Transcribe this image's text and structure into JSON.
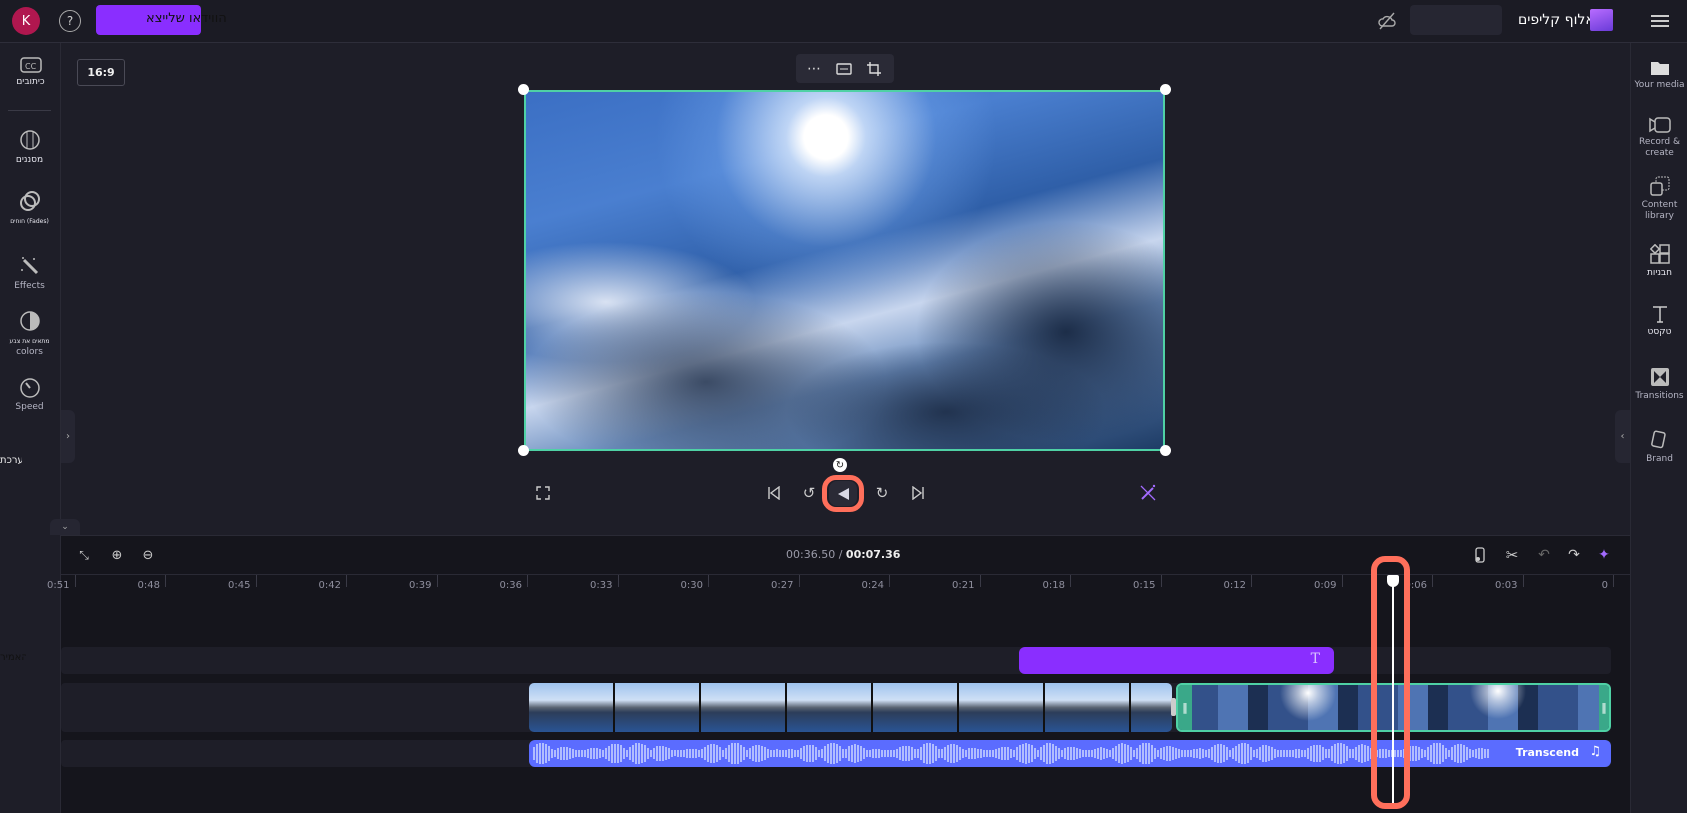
{
  "topbar": {
    "brand": "אלוף קליפים",
    "export_label": "הווידאו שלייצא",
    "avatar_letter": "K",
    "menu_icon": "hamburger-icon",
    "cloud_icon": "cloud-off-icon",
    "help_icon": "help-icon"
  },
  "preview": {
    "aspect_ratio": "16:9",
    "toolbar_icons": [
      "more-icon",
      "fit-icon",
      "crop-icon"
    ]
  },
  "left_sidebar": {
    "items": [
      {
        "label": "כיתובים",
        "icon": "captions-icon"
      },
      {
        "label": "מסננים",
        "icon": "filters-icon"
      },
      {
        "label": "חוחים (Fades)",
        "icon": "fade-icon"
      },
      {
        "label": "Effects",
        "icon": "effects-icon"
      },
      {
        "label": "מתאים את צבע",
        "label2": "colors",
        "icon": "adjust-colors-icon"
      },
      {
        "label": "Speed",
        "icon": "speed-icon"
      }
    ],
    "extra_label": "ערכת"
  },
  "right_sidebar": {
    "items": [
      {
        "label": "Your media",
        "icon": "folder-icon"
      },
      {
        "label": "Record &",
        "label2": "create",
        "icon": "record-icon"
      },
      {
        "label": "Content",
        "label2": "library",
        "icon": "content-library-icon"
      },
      {
        "label": "חבניות",
        "icon": "templates-icon"
      },
      {
        "label": "טקסט",
        "icon": "text-icon"
      },
      {
        "label": "Transitions",
        "icon": "transitions-icon"
      },
      {
        "label": "Brand",
        "icon": "brand-icon"
      }
    ]
  },
  "playback": {
    "icons": [
      "fullscreen-icon",
      "skip-back-icon",
      "rewind-5-icon",
      "play-icon",
      "forward-5-icon",
      "skip-forward-icon",
      "magic-off-icon"
    ]
  },
  "timeline": {
    "current_time": "00:07.36",
    "separator": "/",
    "total_time": "00:36.50",
    "ruler": [
      "0",
      "0:03",
      "0:06",
      "0:09",
      "0:12",
      "0:15",
      "0:18",
      "0:21",
      "0:24",
      "0:27",
      "0:30",
      "0:33",
      "0:36",
      "0:39",
      "0:42",
      "0:45",
      "0:48",
      "0:51"
    ],
    "track_label": "האמיר",
    "audio_clip": "Transcend",
    "playhead_time": "0:07.36"
  },
  "colors": {
    "accent": "#8a2eff",
    "clip_border": "#4fd1a5",
    "audio": "#5b6cff",
    "highlight": "#ff6f5b",
    "avatar": "#b0174f"
  }
}
